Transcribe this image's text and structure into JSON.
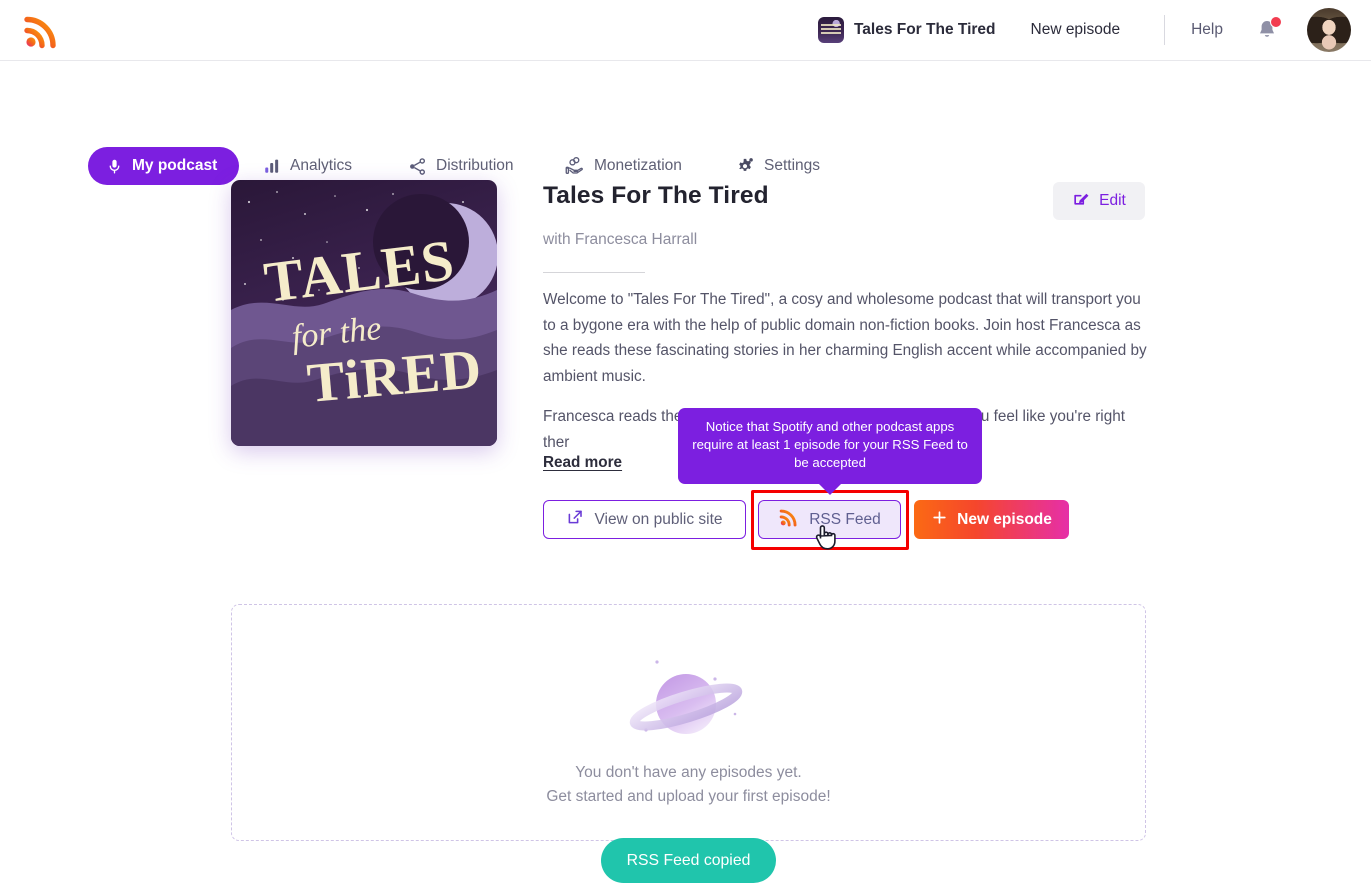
{
  "header": {
    "logo_icon": "rss-logo-icon",
    "podcast_name": "Tales For The Tired",
    "new_episode_link": "New episode",
    "help_label": "Help",
    "notification_icon": "bell-icon",
    "avatar_icon": "user-avatar"
  },
  "nav": {
    "tabs": [
      {
        "label": "My podcast",
        "icon": "microphone-icon",
        "active": true
      },
      {
        "label": "Analytics",
        "icon": "bar-chart-icon",
        "active": false
      },
      {
        "label": "Distribution",
        "icon": "share-nodes-icon",
        "active": false
      },
      {
        "label": "Monetization",
        "icon": "hand-coins-icon",
        "active": false
      },
      {
        "label": "Settings",
        "icon": "gear-icon",
        "active": false
      }
    ]
  },
  "podcast": {
    "cover_alt": "Tales For The Tired cover art",
    "cover_line1": "TALES",
    "cover_line2": "for the",
    "cover_line3": "TiRED",
    "title": "Tales For The Tired",
    "author": "with Francesca Harrall",
    "description_p1": "Welcome to \"Tales For The Tired\", a cosy and wholesome podcast that will transport you to a bygone era with the help of public domain non-fiction books. Join host Francesca as she reads these fascinating stories in her charming English accent while accompanied by ambient music.",
    "description_p2": "Francesca reads these old books in a casual style that makes you feel like you're right ther",
    "read_more": "Read more",
    "edit_label": "Edit",
    "edit_icon": "pencil-square-icon"
  },
  "actions": {
    "view_public_label": "View on public site",
    "view_public_icon": "external-link-icon",
    "rss_label": "RSS Feed",
    "rss_icon": "rss-icon",
    "new_episode_label": "New episode",
    "new_episode_icon": "plus-icon",
    "cursor_icon": "pointing-hand-cursor"
  },
  "tooltip": {
    "text": "Notice that Spotify and other podcast apps require at least 1 episode for your RSS Feed to be accepted"
  },
  "empty_state": {
    "illustration": "planet-saturn-icon",
    "line1": "You don't have any episodes yet.",
    "line2": "Get started and upload your first episode!"
  },
  "toast": {
    "message": "RSS Feed copied"
  },
  "colors": {
    "accent_purple": "#7c1fe0",
    "gradient_start": "#fb6a14",
    "gradient_end": "#e62fa8",
    "toast_teal": "#20c5ac",
    "highlight_red": "#f50000",
    "notification_red": "#f23c50"
  }
}
